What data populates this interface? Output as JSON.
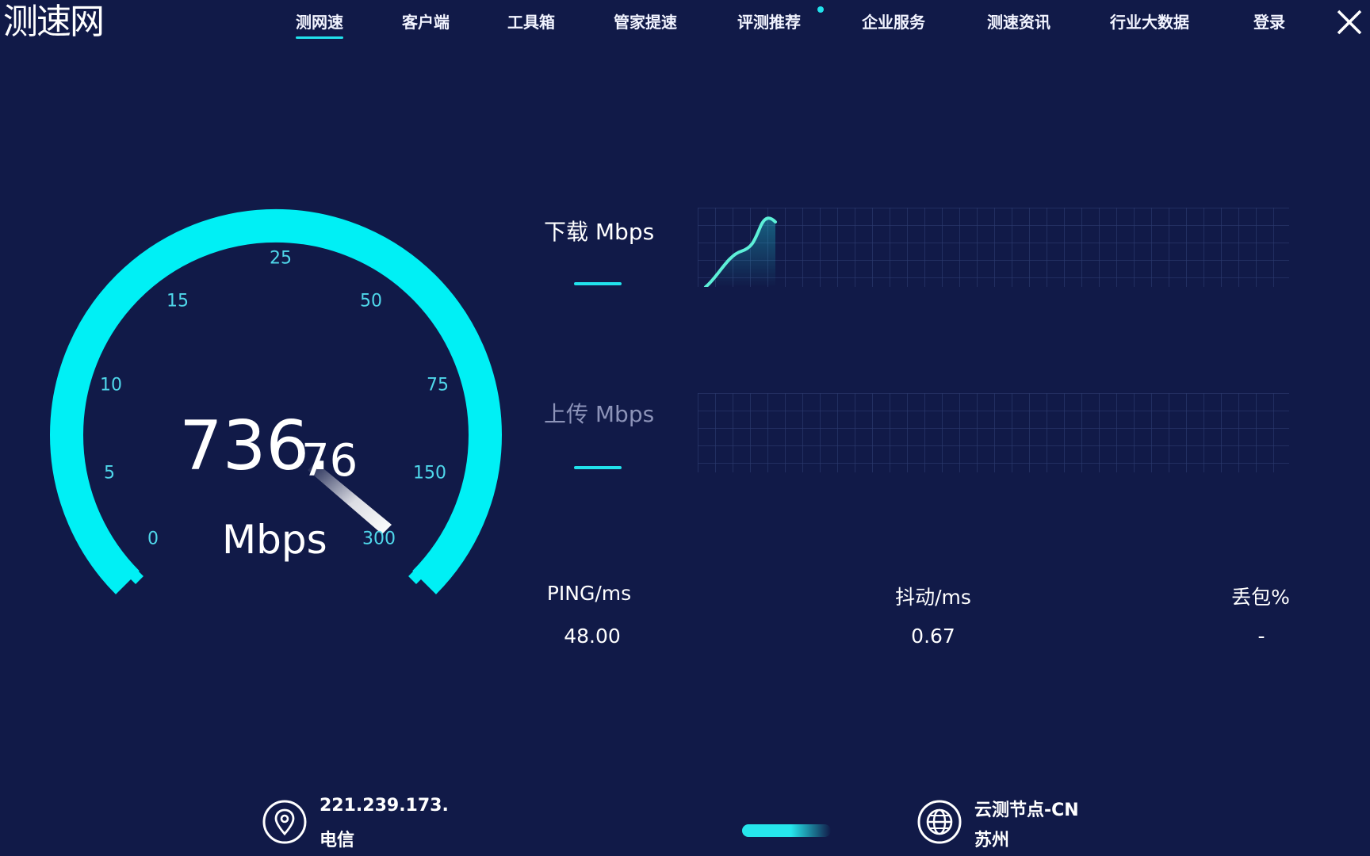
{
  "app": {
    "logo": "测速网"
  },
  "nav": {
    "items": [
      {
        "label": "测网速",
        "active": true
      },
      {
        "label": "客户端"
      },
      {
        "label": "工具箱"
      },
      {
        "label": "管家提速"
      },
      {
        "label": "评测推荐"
      },
      {
        "label": "企业服务"
      },
      {
        "label": "测速资讯"
      },
      {
        "label": "行业大数据"
      },
      {
        "label": "登录"
      }
    ]
  },
  "gauge": {
    "ticks": [
      "0",
      "5",
      "10",
      "15",
      "25",
      "50",
      "75",
      "150",
      "300"
    ],
    "speed_integer": "736.",
    "speed_decimal": "76",
    "unit": "Mbps"
  },
  "download": {
    "label": "下载 Mbps"
  },
  "upload": {
    "label": "上传 Mbps"
  },
  "stats": [
    {
      "label": "PING/ms",
      "value": "48.00"
    },
    {
      "label": "抖动/ms",
      "value": "0.67"
    },
    {
      "label": "丢包%",
      "value": "-"
    }
  ],
  "footer": {
    "ip": "221.239.173.",
    "isp": "电信",
    "node": "云测节点-CN",
    "city": "苏州"
  },
  "colors": {
    "background": "#111a48",
    "accent": "#21e2ec",
    "tick_text": "#4fd7ea"
  }
}
